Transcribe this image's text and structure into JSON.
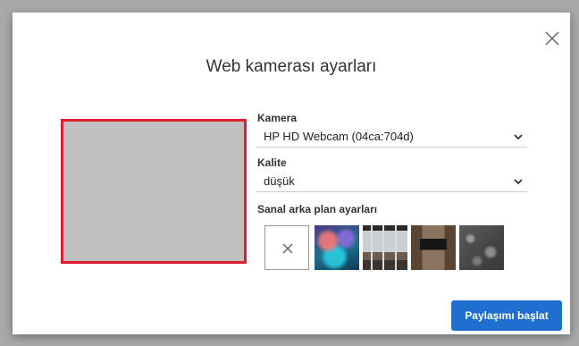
{
  "dialog": {
    "title": "Web kamerası ayarları",
    "close_icon": "close-icon"
  },
  "camera": {
    "label": "Kamera",
    "selected": "HP HD Webcam (04ca:704d)"
  },
  "quality": {
    "label": "Kalite",
    "selected": "düşük"
  },
  "virtual_background": {
    "label": "Sanal arka plan ayarları",
    "options": [
      {
        "icon": "no-background-icon"
      },
      {
        "icon": "bokeh-background-thumbnail"
      },
      {
        "icon": "office-background-thumbnail"
      },
      {
        "icon": "living-room-background-thumbnail"
      },
      {
        "icon": "stone-background-thumbnail"
      }
    ]
  },
  "actions": {
    "start_sharing_label": "Paylaşımı başlat"
  },
  "colors": {
    "accent": "#1f6fd1",
    "preview_border": "#e01e2d",
    "preview_fill": "#c0c0c0"
  }
}
